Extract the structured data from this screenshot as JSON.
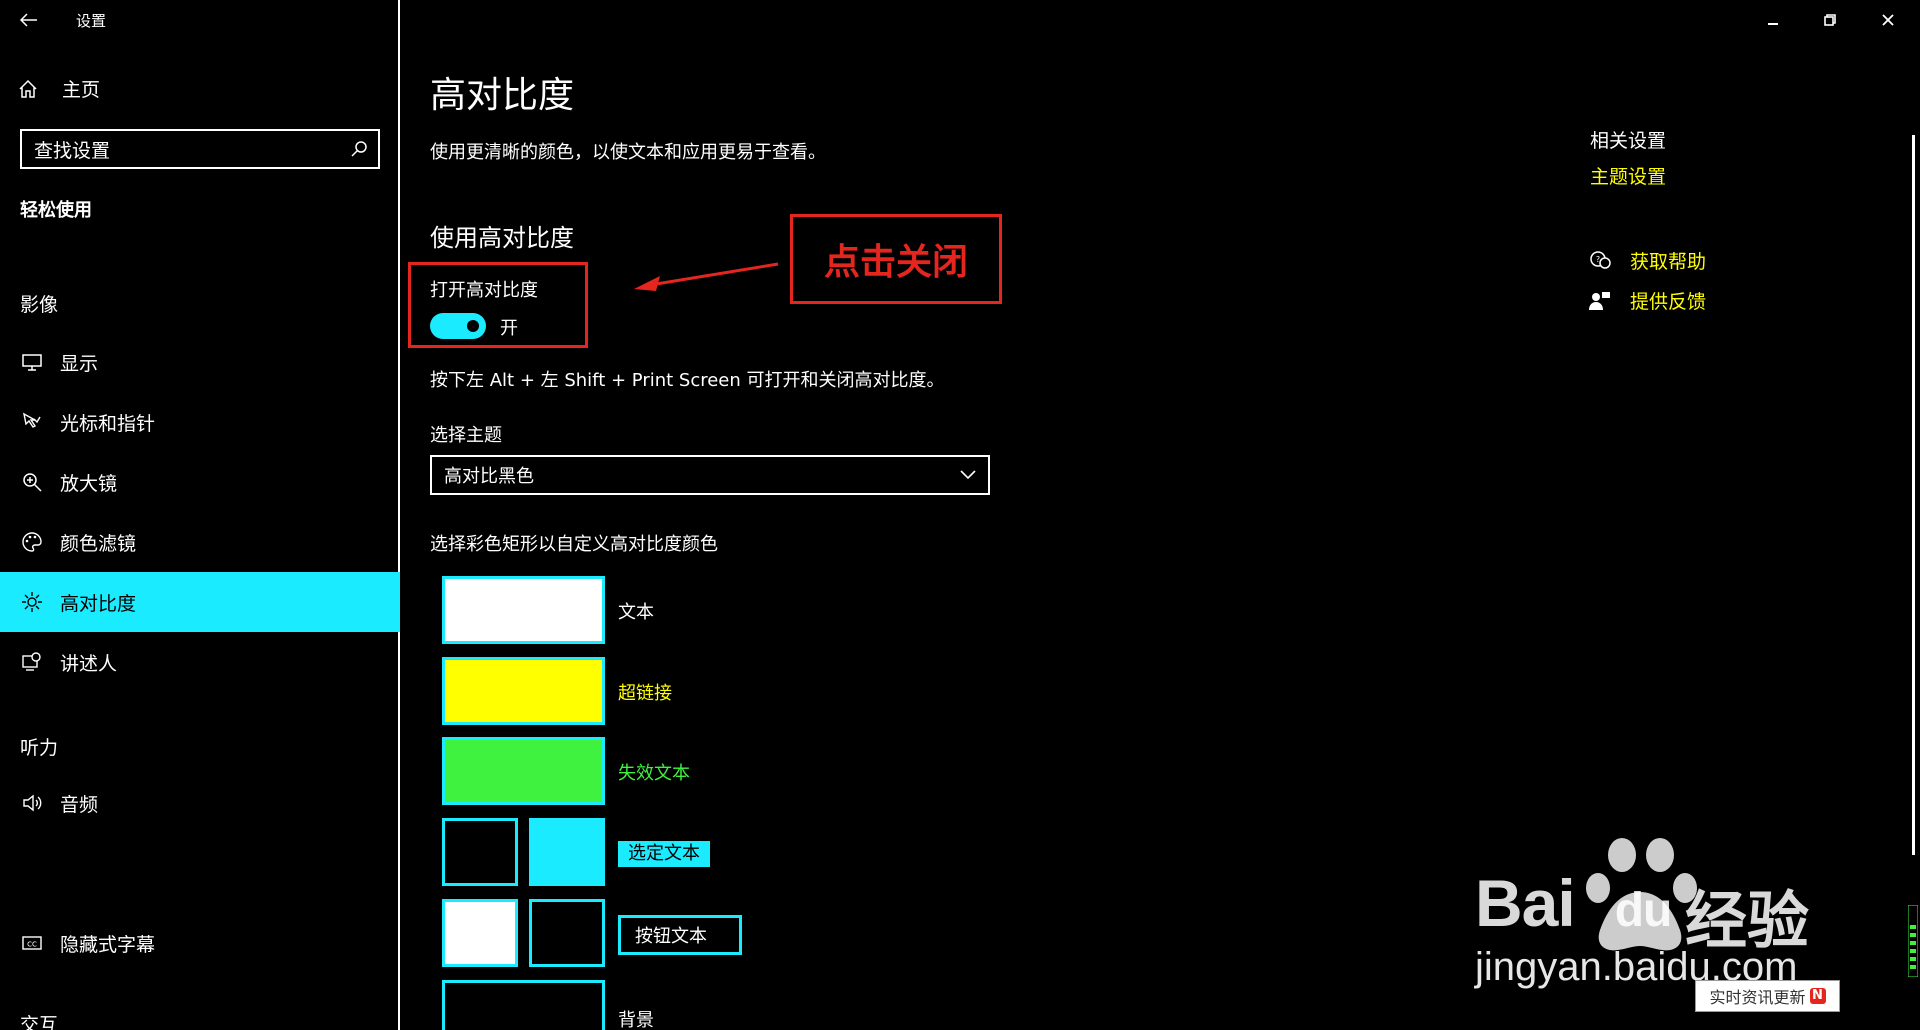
{
  "app": {
    "title": "设置"
  },
  "sidebar": {
    "home": "主页",
    "search_placeholder": "查找设置",
    "section": "轻松使用",
    "groups": {
      "vision": "影像",
      "hearing": "听力",
      "interaction": "交互"
    },
    "items": [
      {
        "label": "显示",
        "icon": "monitor-icon"
      },
      {
        "label": "光标和指针",
        "icon": "cursor-pointer-icon"
      },
      {
        "label": "放大镜",
        "icon": "magnifier-icon"
      },
      {
        "label": "颜色滤镜",
        "icon": "color-filter-icon"
      },
      {
        "label": "高对比度",
        "icon": "contrast-sun-icon",
        "active": true
      },
      {
        "label": "讲述人",
        "icon": "narrator-icon"
      },
      {
        "label": "音频",
        "icon": "speaker-icon"
      },
      {
        "label": "隐藏式字幕",
        "icon": "closed-caption-icon"
      }
    ]
  },
  "main": {
    "title": "高对比度",
    "description": "使用更清晰的颜色，以使文本和应用更易于查看。",
    "section_title": "使用高对比度",
    "toggle_label": "打开高对比度",
    "toggle_state": "开",
    "toggle_on": true,
    "hotkey_note": "按下左 Alt + 左 Shift + Print Screen 可打开和关闭高对比度。",
    "theme_label": "选择主题",
    "theme_value": "高对比黑色",
    "colors_label": "选择彩色矩形以自定义高对比度颜色",
    "colors": {
      "text": {
        "label": "文本",
        "color": "#ffffff"
      },
      "hyperlink": {
        "label": "超链接",
        "color": "#ffff00"
      },
      "disabled": {
        "label": "失效文本",
        "color": "#3ff23f"
      },
      "selected": {
        "label": "选定文本",
        "fg": "#000000",
        "bg": "#1aebff"
      },
      "button": {
        "label": "按钮文本",
        "fg": "#ffffff",
        "bg": "#000000"
      },
      "background": {
        "label": "背景",
        "color": "#000000"
      }
    },
    "accent": "#1aebff"
  },
  "annotation": {
    "text": "点击关闭",
    "color": "#e5261f"
  },
  "related": {
    "title": "相关设置",
    "theme_link": "主题设置",
    "help": "获取帮助",
    "feedback": "提供反馈"
  },
  "watermark": {
    "brand": "Bai",
    "brand_du": "du",
    "brand_cn": "经验",
    "url": "jingyan.baidu.com",
    "badge": "实时资讯更新",
    "badge_mark": "N"
  }
}
